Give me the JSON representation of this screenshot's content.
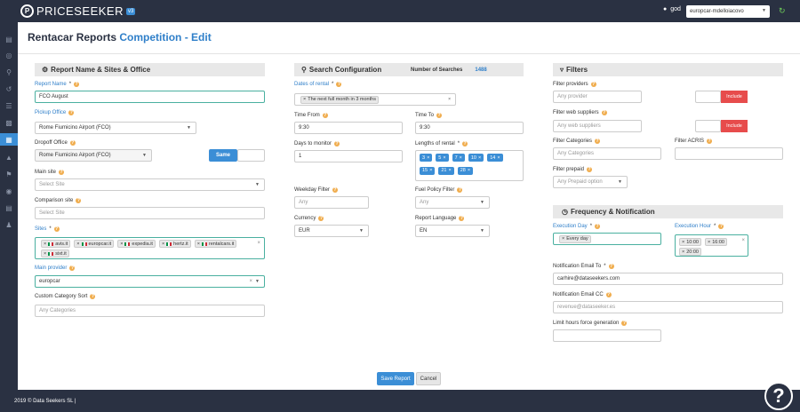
{
  "header": {
    "logo_text": "PRICESEEKER",
    "logo_version": "v3",
    "user": "god",
    "account": "europcar-mdelloiacovo"
  },
  "page": {
    "title_prefix": "Rentacar Reports",
    "title_main": "Competition - Edit"
  },
  "report_section": {
    "heading": "Report Name & Sites & Office",
    "report_name_label": "Report Name",
    "report_name_value": "FCO August",
    "pickup_office_label": "Pickup Office",
    "pickup_office_value": "Rome Fiumicino Airport (FCO)",
    "dropoff_office_label": "Dropoff Office",
    "dropoff_office_value": "Rome Fiumicino Airport (FCO)",
    "same_label": "Same",
    "main_site_label": "Main site",
    "main_site_placeholder": "Select Site",
    "comparison_site_label": "Comparison site",
    "comparison_site_placeholder": "Select Site",
    "sites_label": "Sites",
    "sites": [
      "avis.it",
      "europcar.it",
      "expedia.it",
      "hertz.it",
      "rentalcars.it",
      "sixt.it"
    ],
    "main_provider_label": "Main provider",
    "main_provider_value": "europcar",
    "custom_sort_label": "Custom Category Sort",
    "custom_sort_placeholder": "Any Categories"
  },
  "search_section": {
    "heading": "Search Configuration",
    "num_searches_label": "Number of Searches",
    "num_searches_value": "1488",
    "dates_label": "Dates of rental",
    "dates_value": "The next full month in 3 months",
    "time_from_label": "Time From",
    "time_from_value": "9:30",
    "time_to_label": "Time To",
    "time_to_value": "9:30",
    "days_label": "Days to monitor",
    "days_value": "1",
    "lengths_label": "Lengths of rental",
    "lengths": [
      "3",
      "5",
      "7",
      "10",
      "14",
      "15",
      "21",
      "28"
    ],
    "weekday_label": "Weekday Filter",
    "weekday_placeholder": "Any",
    "fuel_label": "Fuel Policy Filter",
    "fuel_placeholder": "Any",
    "currency_label": "Currency",
    "currency_value": "EUR",
    "language_label": "Report Language",
    "language_value": "EN"
  },
  "filters_section": {
    "heading": "Filters",
    "providers_label": "Filter providers",
    "providers_placeholder": "Any provider",
    "web_suppliers_label": "Filter web suppliers",
    "web_suppliers_placeholder": "Any web suppliers",
    "include_label": "Include",
    "categories_label": "Filter Categories",
    "categories_placeholder": "Any Categories",
    "acriss_label": "Filter ACRIS",
    "prepaid_label": "Filter prepaid",
    "prepaid_placeholder": "Any Prepaid option"
  },
  "frequency_section": {
    "heading": "Frequency & Notification",
    "exec_day_label": "Execution Day",
    "exec_day_value": "Every day",
    "exec_hour_label": "Execution Hour",
    "exec_hours": [
      "10:00",
      "16:00",
      "20:00"
    ],
    "email_to_label": "Notification Email To",
    "email_to_value": "carhire@dataseekers.com",
    "email_cc_label": "Notification Email CC",
    "email_cc_placeholder": "revenue@dataseeker.es",
    "limit_label": "Limit hours force generation"
  },
  "actions": {
    "save": "Save Report",
    "cancel": "Cancel"
  },
  "footer": {
    "text": "2019 © Data Seekers SL  |"
  }
}
